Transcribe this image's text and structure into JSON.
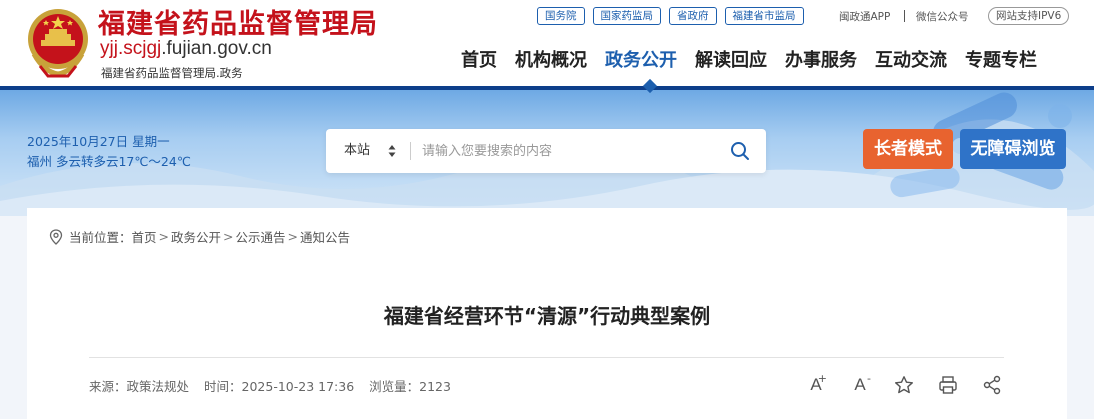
{
  "header": {
    "title": "福建省药品监督管理局",
    "domain_prefix": "yjj.scjgj",
    "domain_suffix": ".fujian.gov.cn",
    "subtitle": "福建省药品监督管理局.政务",
    "top_links": [
      "国务院",
      "国家药监局",
      "省政府",
      "福建省市监局"
    ],
    "app_link": "闽政通APP",
    "wechat_link": "微信公众号",
    "ipv6_badge": "网站支持IPV6",
    "nav": [
      "首页",
      "机构概况",
      "政务公开",
      "解读回应",
      "办事服务",
      "互动交流",
      "专题专栏"
    ],
    "nav_active": "政务公开"
  },
  "banner": {
    "date": "2025年10月27日 星期一",
    "weather": "福州 多云转多云17℃～24℃",
    "search_scope": "本站",
    "search_placeholder": "请输入您要搜索的内容",
    "elder_mode": "长者模式",
    "accessible": "无障碍浏览"
  },
  "breadcrumb": {
    "label": "当前位置：",
    "items": [
      "首页",
      "政务公开",
      "公示通告",
      "通知公告"
    ],
    "separator": ">"
  },
  "article": {
    "title": "福建省经营环节“清源”行动典型案例",
    "source": "来源：政策法规处",
    "time": "时间：2025-10-23 17:36",
    "views": "浏览量：2123"
  },
  "tools": {
    "font_larger": "A",
    "font_larger_sup": "+",
    "font_smaller": "A",
    "font_smaller_sup": "-"
  },
  "colors": {
    "brand_red": "#c4121b",
    "brand_blue": "#1d5fae",
    "elder_orange": "#e8632f",
    "access_blue": "#2f73c8"
  },
  "icons": [
    "national-emblem-icon",
    "search-icon",
    "chevron-updown-icon",
    "location-pin-icon",
    "font-larger-icon",
    "font-smaller-icon",
    "star-icon",
    "print-icon",
    "share-icon"
  ]
}
